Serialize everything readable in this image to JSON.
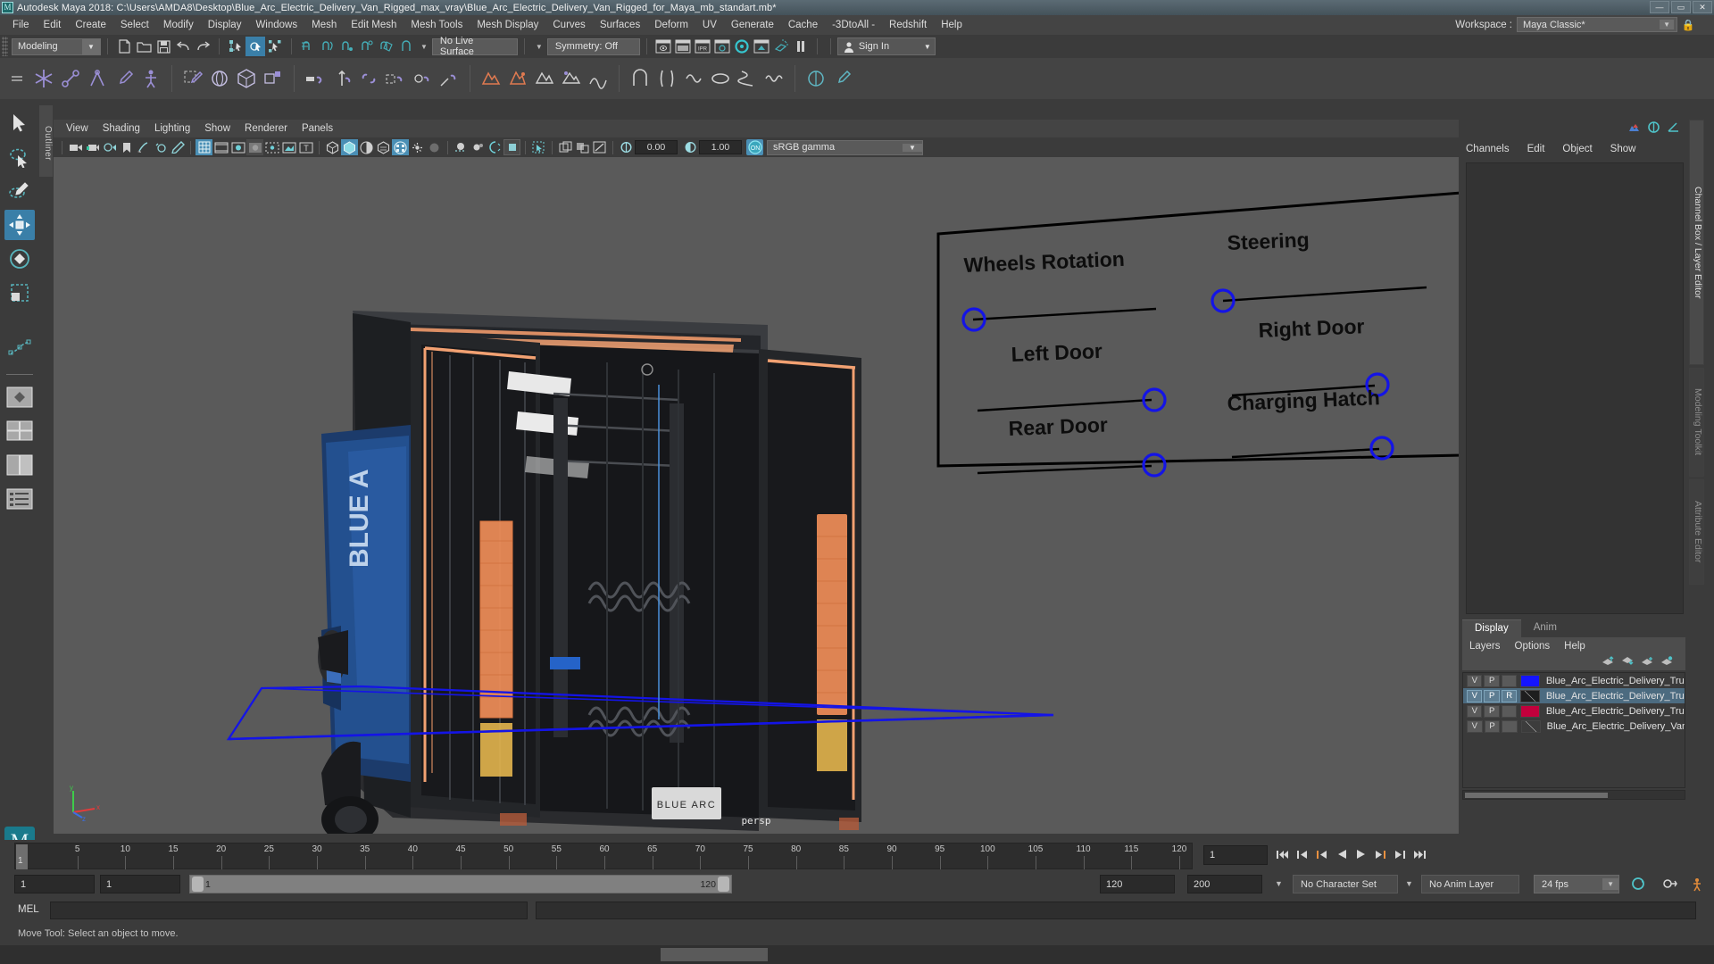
{
  "titlebar": {
    "app_icon": "maya-icon",
    "title": "Autodesk Maya 2018: C:\\Users\\AMDA8\\Desktop\\Blue_Arc_Electric_Delivery_Van_Rigged_max_vray\\Blue_Arc_Electric_Delivery_Van_Rigged_for_Maya_mb_standart.mb*",
    "minimize": "—",
    "maximize": "▭",
    "close": "✕"
  },
  "menubar": {
    "items": [
      "File",
      "Edit",
      "Create",
      "Select",
      "Modify",
      "Display",
      "Windows",
      "Mesh",
      "Edit Mesh",
      "Mesh Tools",
      "Mesh Display",
      "Curves",
      "Surfaces",
      "Deform",
      "UV",
      "Generate",
      "Cache",
      "-3DtoAll -",
      "Redshift",
      "Help"
    ],
    "workspace_label": "Workspace :",
    "workspace_value": "Maya Classic*",
    "lock_icon": "lock-icon"
  },
  "statusline": {
    "mode": "Modeling",
    "live_surface": "No Live Surface",
    "symmetry": "Symmetry: Off",
    "signin": "Sign In"
  },
  "viewport_panel": {
    "menus": [
      "View",
      "Shading",
      "Lighting",
      "Show",
      "Renderer",
      "Panels"
    ],
    "exposure": "0.00",
    "gamma": "1.00",
    "color_space": "sRGB gamma",
    "camera_label": "persp"
  },
  "rig_panel": {
    "controls": [
      {
        "label": "Wheels Rotation",
        "handle": "left"
      },
      {
        "label": "Steering",
        "handle": "left"
      },
      {
        "label": "Left Door",
        "handle": "right"
      },
      {
        "label": "Right Door",
        "handle": "right"
      },
      {
        "label": "Rear Door",
        "handle": "right"
      },
      {
        "label": "Charging Hatch",
        "handle": "right"
      }
    ],
    "handle_color": "#1414e6",
    "line_color": "#000000",
    "panel_border_color": "#000000"
  },
  "right_panel": {
    "channelbox_menus": [
      "Channels",
      "Edit",
      "Object",
      "Show"
    ],
    "layer_editor": {
      "tabs": [
        {
          "label": "Display",
          "active": true
        },
        {
          "label": "Anim",
          "active": false
        }
      ],
      "menus": [
        "Layers",
        "Options",
        "Help"
      ],
      "layers": [
        {
          "v": "V",
          "p": "P",
          "r": "",
          "color": "#1414ff",
          "name": "Blue_Arc_Electric_Delivery_Truc",
          "selected": false
        },
        {
          "v": "V",
          "p": "P",
          "r": "R",
          "color": "#2b2b2b",
          "name": "Blue_Arc_Electric_Delivery_Truc",
          "selected": true
        },
        {
          "v": "V",
          "p": "P",
          "r": "",
          "color": "#c2003c",
          "name": "Blue_Arc_Electric_Delivery_Truc",
          "selected": false
        },
        {
          "v": "V",
          "p": "P",
          "r": "",
          "color": "#4a4a4a",
          "name": "Blue_Arc_Electric_Delivery_Van",
          "selected": false
        }
      ]
    },
    "side_tabs": [
      {
        "label": "Channel Box / Layer Editor",
        "active": true
      },
      {
        "label": "Modeling Toolkit",
        "active": false
      },
      {
        "label": "Attribute Editor",
        "active": false
      }
    ]
  },
  "outliner_tab": "Outliner",
  "timeline": {
    "ticks": [
      5,
      10,
      15,
      20,
      25,
      30,
      35,
      40,
      45,
      50,
      55,
      60,
      65,
      70,
      75,
      80,
      85,
      90,
      95,
      100,
      105,
      110,
      115,
      120
    ],
    "current_frame": "1",
    "current_frame_field": "1",
    "range_start": "1",
    "range_start_2": "1",
    "bar_start": "1",
    "bar_end": "120",
    "range_end": "120",
    "playback_end": "200",
    "character_set": "No Character Set",
    "anim_layer": "No Anim Layer",
    "fps": "24 fps"
  },
  "command_line": {
    "language": "MEL",
    "input_value": "",
    "output_value": ""
  },
  "status_bar": {
    "message": "Move Tool: Select an object to move."
  }
}
